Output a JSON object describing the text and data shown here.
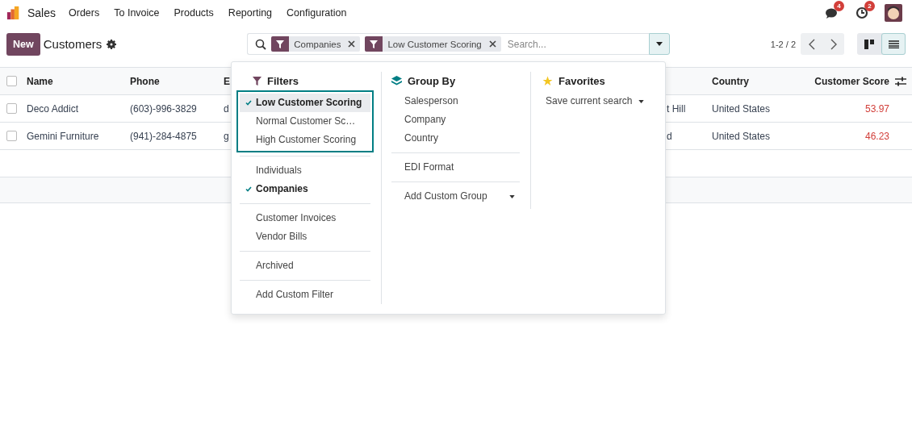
{
  "navbar": {
    "app": "Sales",
    "menu": [
      "Orders",
      "To Invoice",
      "Products",
      "Reporting",
      "Configuration"
    ],
    "messages_badge": "4",
    "activities_badge": "2"
  },
  "control_panel": {
    "new_button": "New",
    "title": "Customers",
    "facets": [
      "Companies",
      "Low Customer Scoring"
    ],
    "search_placeholder": "Search...",
    "pager": "1-2 / 2",
    "views": [
      {
        "kind": "kanban",
        "selected": false
      },
      {
        "kind": "list",
        "selected": true
      }
    ]
  },
  "table": {
    "select_all_checked": false,
    "columns": [
      "Name",
      "Phone",
      "E",
      "",
      "Country",
      "Customer Score"
    ],
    "rows": [
      {
        "checked": false,
        "cells": [
          "Deco Addict",
          "(603)-996-3829",
          "d",
          "t Hill",
          "United States",
          "53.97"
        ]
      },
      {
        "checked": false,
        "cells": [
          "Gemini Furniture",
          "(941)-284-4875",
          "g",
          "d",
          "United States",
          "46.23"
        ]
      }
    ]
  },
  "dropdown": {
    "filters_title": "Filters",
    "filter_groups": [
      {
        "highlighted": true,
        "items": [
          {
            "label": "Low Customer Scoring",
            "checked": true,
            "hovered": true
          },
          {
            "label": "Normal Customer Sc…",
            "checked": false,
            "hovered": false
          },
          {
            "label": "High Customer Scoring",
            "checked": false,
            "hovered": false
          }
        ]
      },
      {
        "highlighted": false,
        "items": [
          {
            "label": "Individuals",
            "checked": false,
            "hovered": false
          },
          {
            "label": "Companies",
            "checked": true,
            "hovered": false
          }
        ]
      },
      {
        "highlighted": false,
        "items": [
          {
            "label": "Customer Invoices",
            "checked": false,
            "hovered": false
          },
          {
            "label": "Vendor Bills",
            "checked": false,
            "hovered": false
          }
        ]
      },
      {
        "highlighted": false,
        "items": [
          {
            "label": "Archived",
            "checked": false,
            "hovered": false
          }
        ]
      },
      {
        "highlighted": false,
        "items": [
          {
            "label": "Add Custom Filter",
            "checked": false,
            "hovered": false
          }
        ]
      }
    ],
    "groupby_title": "Group By",
    "groupby_groups": [
      [
        "Salesperson",
        "Company",
        "Country"
      ],
      [
        "EDI Format"
      ]
    ],
    "add_custom_group": "Add Custom Group",
    "favorites_title": "Favorites",
    "save_search": "Save current search"
  }
}
